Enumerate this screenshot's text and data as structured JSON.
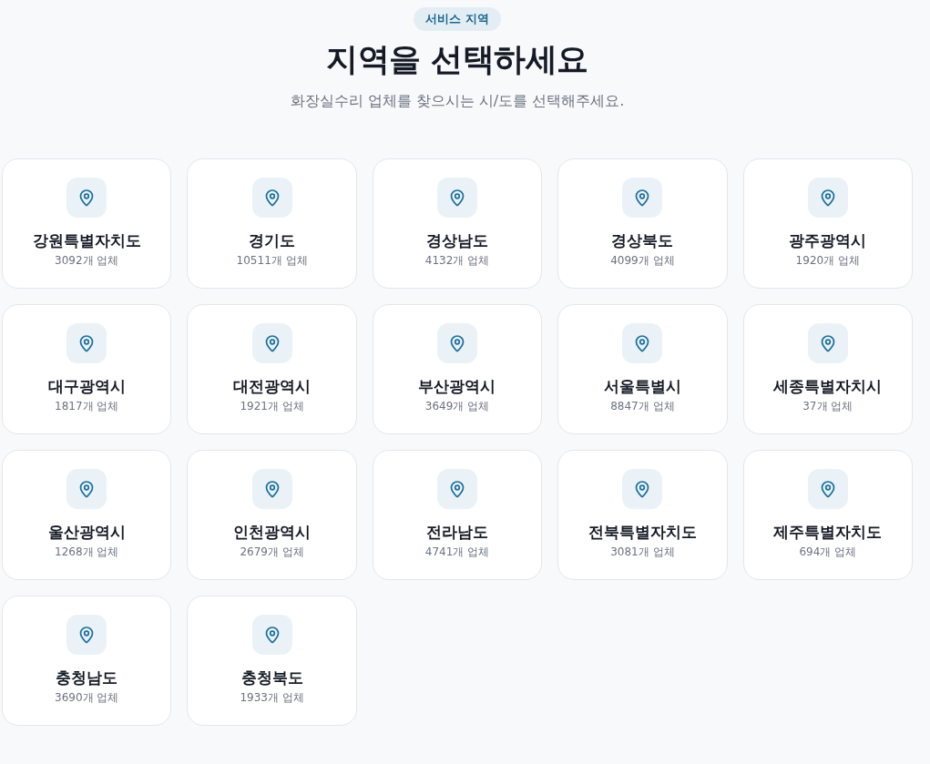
{
  "header": {
    "badge": "서비스 지역",
    "title": "지역을 선택하세요",
    "subtitle": "화장실수리 업체를 찾으시는 시/도를 선택해주세요."
  },
  "regions": [
    {
      "name": "강원특별자치도",
      "count": "3092개 업체"
    },
    {
      "name": "경기도",
      "count": "10511개 업체"
    },
    {
      "name": "경상남도",
      "count": "4132개 업체"
    },
    {
      "name": "경상북도",
      "count": "4099개 업체"
    },
    {
      "name": "광주광역시",
      "count": "1920개 업체"
    },
    {
      "name": "대구광역시",
      "count": "1817개 업체"
    },
    {
      "name": "대전광역시",
      "count": "1921개 업체"
    },
    {
      "name": "부산광역시",
      "count": "3649개 업체"
    },
    {
      "name": "서울특별시",
      "count": "8847개 업체"
    },
    {
      "name": "세종특별자치시",
      "count": "37개 업체"
    },
    {
      "name": "울산광역시",
      "count": "1268개 업체"
    },
    {
      "name": "인천광역시",
      "count": "2679개 업체"
    },
    {
      "name": "전라남도",
      "count": "4741개 업체"
    },
    {
      "name": "전북특별자치도",
      "count": "3081개 업체"
    },
    {
      "name": "제주특별자치도",
      "count": "694개 업체"
    },
    {
      "name": "충청남도",
      "count": "3690개 업체"
    },
    {
      "name": "충청북도",
      "count": "1933개 업체"
    }
  ]
}
